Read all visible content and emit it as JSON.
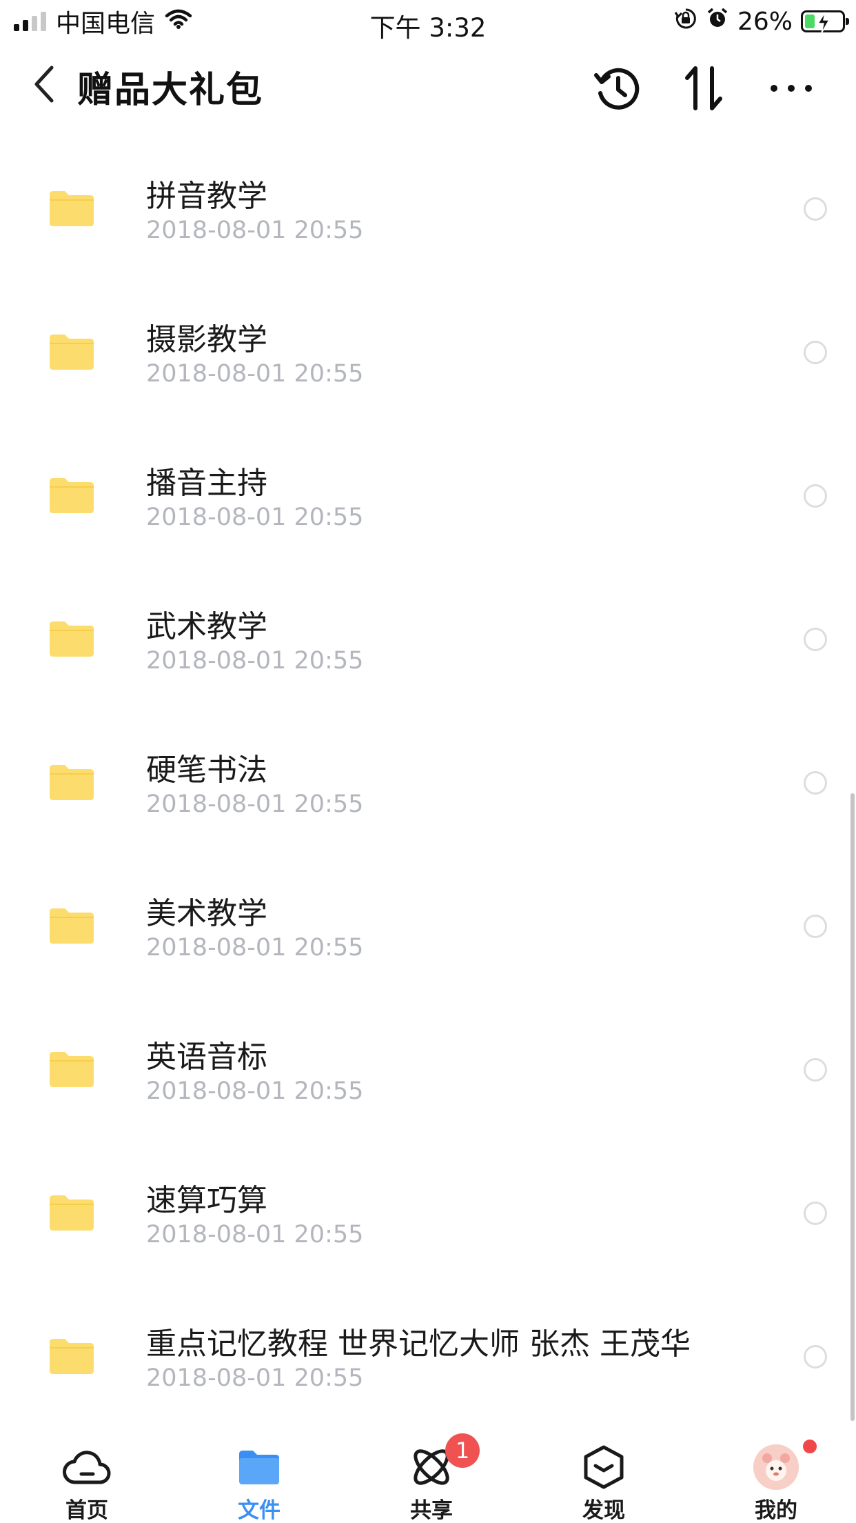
{
  "status_bar": {
    "carrier": "中国电信",
    "time": "下午 3:32",
    "battery": "26%",
    "battery_level": 0.26
  },
  "nav": {
    "title": "赠品大礼包"
  },
  "files": [
    {
      "name": "拼音教学",
      "date": "2018-08-01 20:55"
    },
    {
      "name": "摄影教学",
      "date": "2018-08-01 20:55"
    },
    {
      "name": "播音主持",
      "date": "2018-08-01 20:55"
    },
    {
      "name": "武术教学",
      "date": "2018-08-01 20:55"
    },
    {
      "name": "硬笔书法",
      "date": "2018-08-01 20:55"
    },
    {
      "name": "美术教学",
      "date": "2018-08-01 20:55"
    },
    {
      "name": "英语音标",
      "date": "2018-08-01 20:55"
    },
    {
      "name": "速算巧算",
      "date": "2018-08-01 20:55"
    },
    {
      "name": "重点记忆教程 世界记忆大师 张杰 王茂华",
      "date": "2018-08-01 20:55"
    }
  ],
  "tabs": [
    {
      "label": "首页",
      "icon": "cloud-icon"
    },
    {
      "label": "文件",
      "icon": "folder-icon",
      "active": true
    },
    {
      "label": "共享",
      "icon": "share-orbit-icon",
      "badge": "1"
    },
    {
      "label": "发现",
      "icon": "discover-cube-icon"
    },
    {
      "label": "我的",
      "icon": "avatar"
    }
  ],
  "colors": {
    "accent": "#3a8ff2",
    "folder": "#fbdc6c",
    "badge": "#f05252",
    "date_text": "#b4b6bd"
  }
}
